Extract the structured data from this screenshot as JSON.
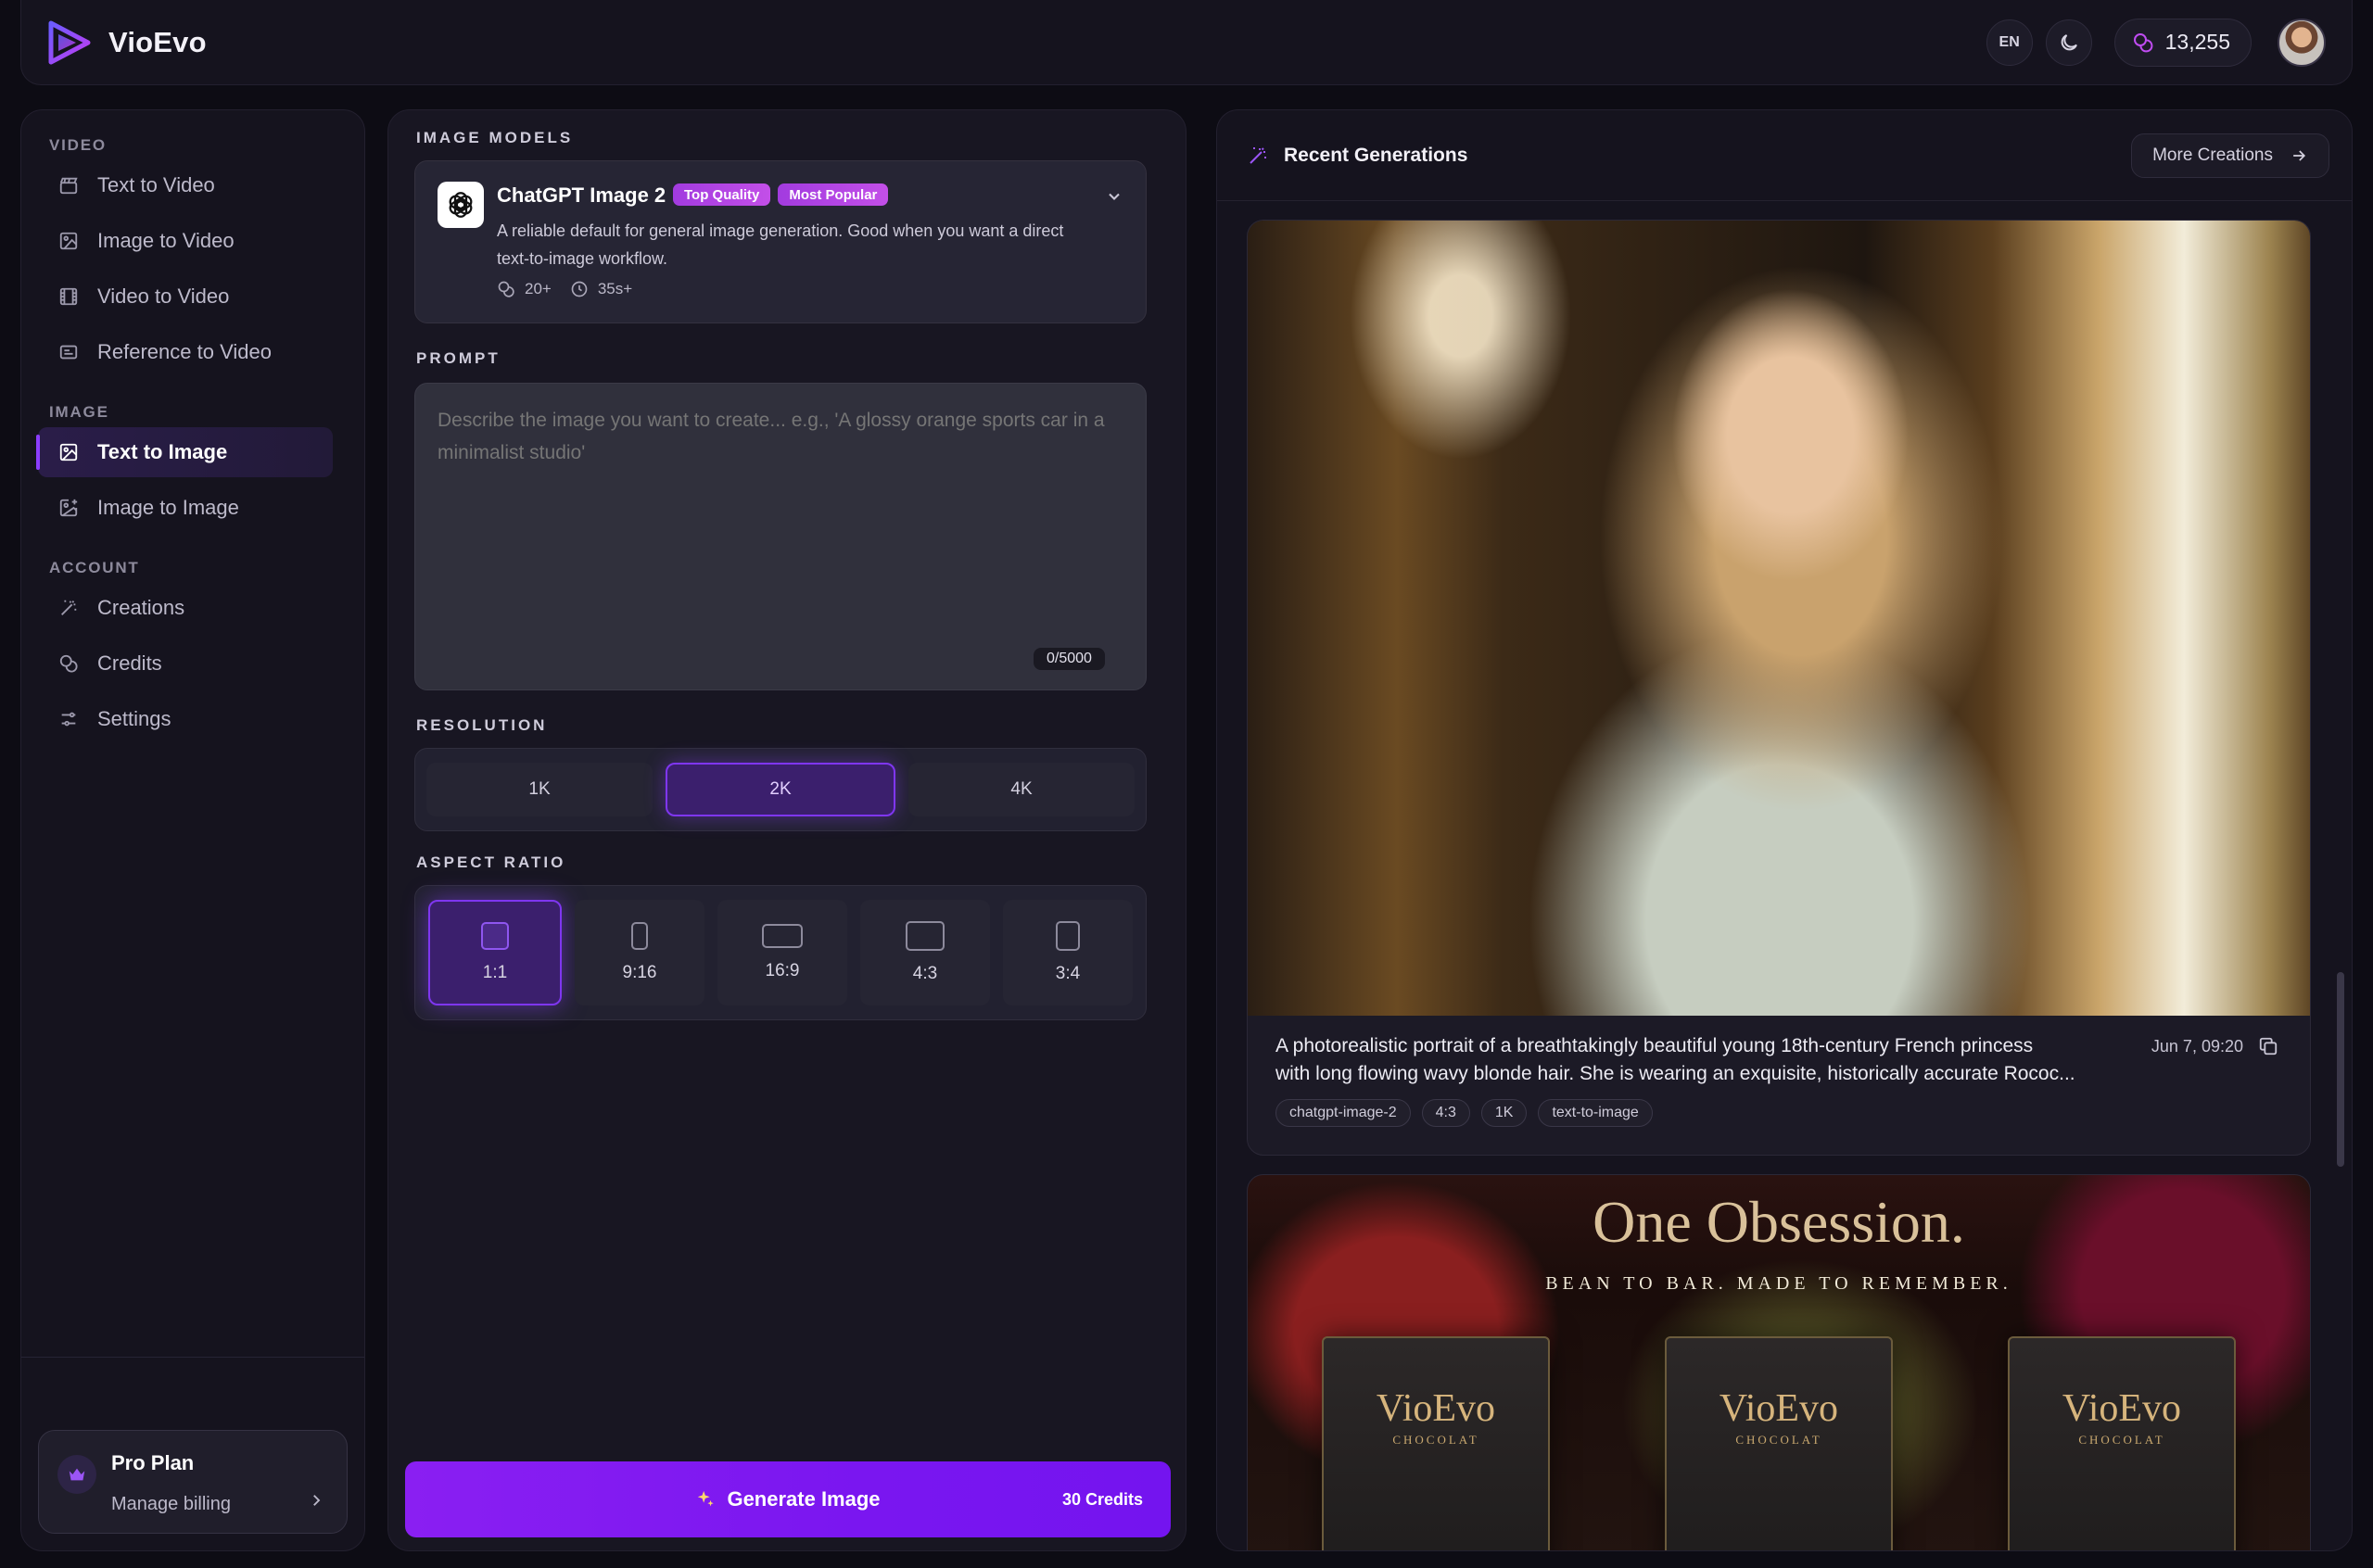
{
  "app": {
    "name": "VioEvo"
  },
  "topbar": {
    "language": "EN",
    "credits": "13,255"
  },
  "sidebar": {
    "sections": [
      {
        "title": "VIDEO",
        "items": [
          {
            "label": "Text to Video",
            "icon": "clapperboard-icon"
          },
          {
            "label": "Image to Video",
            "icon": "image-play-icon"
          },
          {
            "label": "Video to Video",
            "icon": "film-icon"
          },
          {
            "label": "Reference to Video",
            "icon": "video-reference-icon"
          }
        ]
      },
      {
        "title": "IMAGE",
        "items": [
          {
            "label": "Text to Image",
            "icon": "image-icon",
            "active": true
          },
          {
            "label": "Image to Image",
            "icon": "image-plus-icon"
          }
        ]
      },
      {
        "title": "ACCOUNT",
        "items": [
          {
            "label": "Creations",
            "icon": "wand-icon"
          },
          {
            "label": "Credits",
            "icon": "coins-icon"
          },
          {
            "label": "Settings",
            "icon": "sliders-icon"
          }
        ]
      }
    ],
    "plan": {
      "title": "Pro Plan",
      "subtitle": "Manage billing"
    }
  },
  "generator": {
    "models_label": "IMAGE MODELS",
    "model": {
      "name": "ChatGPT Image 2",
      "badges": [
        "Top Quality",
        "Most Popular"
      ],
      "description": "A reliable default for general image generation. Good when you want a direct text-to-image workflow.",
      "cost": "20+",
      "time": "35s+"
    },
    "prompt_label": "PROMPT",
    "prompt_placeholder": "Describe the image you want to create... e.g., 'A glossy orange sports car in a minimalist studio'",
    "prompt_count": "0/5000",
    "resolution_label": "RESOLUTION",
    "resolutions": [
      "1K",
      "2K",
      "4K"
    ],
    "resolution_selected": "2K",
    "aspect_label": "ASPECT RATIO",
    "aspects": [
      "1:1",
      "9:16",
      "16:9",
      "4:3",
      "3:4"
    ],
    "aspect_selected": "1:1",
    "generate_label": "Generate Image",
    "generate_cost": "30 Credits"
  },
  "recent": {
    "title": "Recent Generations",
    "more_label": "More Creations",
    "items": [
      {
        "caption": "A photorealistic portrait of a breathtakingly beautiful young 18th-century French princess\nwith long flowing wavy blonde hair. She is wearing an exquisite, historically accurate Rococ...",
        "date": "Jun 7, 09:20",
        "tags": [
          "chatgpt-image-2",
          "4:3",
          "1K",
          "text-to-image"
        ]
      },
      {
        "headline": "One Obsession.",
        "subline": "BEAN TO BAR. MADE TO REMEMBER.",
        "product_brand": "VioEvo",
        "product_sub": "CHOCOLAT"
      }
    ]
  },
  "colors": {
    "accent": "#7f36f0",
    "badge": "#b046e4",
    "generate": "#8a1ff2"
  }
}
